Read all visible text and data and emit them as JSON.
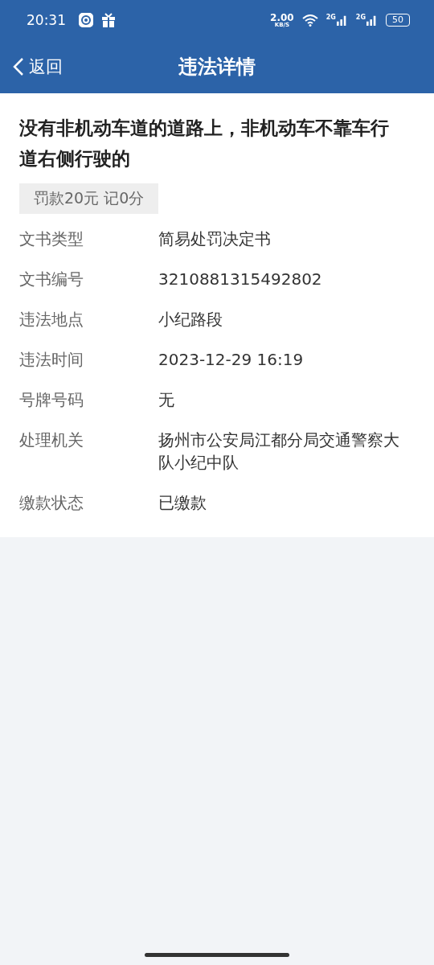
{
  "status_bar": {
    "time": "20:31",
    "speed": "2.00",
    "speed_unit": "KB/S",
    "signals": [
      "2G",
      "2G"
    ],
    "battery": "50"
  },
  "header": {
    "back": "返回",
    "title": "违法详情"
  },
  "violation": {
    "title": "没有非机动车道的道路上，非机动车不靠车行道右侧行驶的",
    "penalty": "罚款20元 记0分"
  },
  "details": [
    {
      "label": "文书类型",
      "value": "简易处罚决定书"
    },
    {
      "label": "文书编号",
      "value": "3210881315492802"
    },
    {
      "label": "违法地点",
      "value": "小纪路段"
    },
    {
      "label": "违法时间",
      "value": "2023-12-29 16:19"
    },
    {
      "label": "号牌号码",
      "value": "无"
    },
    {
      "label": "处理机关",
      "value": "扬州市公安局江都分局交通警察大队小纪中队"
    },
    {
      "label": "缴款状态",
      "value": "已缴款"
    }
  ]
}
